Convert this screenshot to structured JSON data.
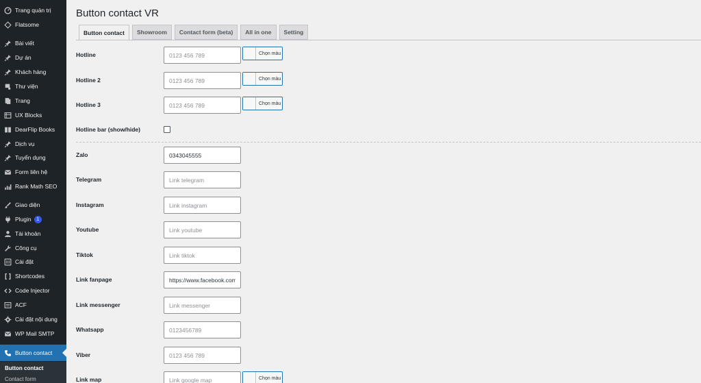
{
  "sidebar": {
    "items": [
      {
        "label": "Trang quản trị",
        "icon": "dashboard-icon"
      },
      {
        "label": "Flatsome",
        "icon": "diamond-icon"
      },
      {
        "label": "Bài viết",
        "icon": "pin-icon"
      },
      {
        "label": "Dự án",
        "icon": "pin-icon"
      },
      {
        "label": "Khách hàng",
        "icon": "pin-icon"
      },
      {
        "label": "Thư viện",
        "icon": "media-icon"
      },
      {
        "label": "Trang",
        "icon": "page-icon"
      },
      {
        "label": "UX Blocks",
        "icon": "blocks-icon"
      },
      {
        "label": "DearFlip Books",
        "icon": "book-icon"
      },
      {
        "label": "Dịch vụ",
        "icon": "pin-icon"
      },
      {
        "label": "Tuyển dụng",
        "icon": "pin-icon"
      },
      {
        "label": "Form liên hệ",
        "icon": "mail-icon"
      },
      {
        "label": "Rank Math SEO",
        "icon": "chart-icon"
      },
      {
        "label": "Giao diện",
        "icon": "brush-icon"
      },
      {
        "label": "Plugin",
        "icon": "plugin-icon",
        "badge": "1"
      },
      {
        "label": "Tài khoản",
        "icon": "user-icon"
      },
      {
        "label": "Công cụ",
        "icon": "wrench-icon"
      },
      {
        "label": "Cài đặt",
        "icon": "settings-icon"
      },
      {
        "label": "Shortcodes",
        "icon": "brackets-icon"
      },
      {
        "label": "Code Injector",
        "icon": "code-icon"
      },
      {
        "label": "ACF",
        "icon": "acf-icon"
      },
      {
        "label": "Cài đặt nội dung",
        "icon": "gear-icon"
      },
      {
        "label": "WP Mail SMTP",
        "icon": "mail-icon"
      },
      {
        "label": "Button contact",
        "icon": "phone-icon",
        "active": true
      }
    ],
    "submenu": [
      {
        "label": "Button contact",
        "current": true
      },
      {
        "label": "Contact form",
        "current": false
      }
    ]
  },
  "page": {
    "title": "Button contact VR",
    "tabs": [
      "Button contact",
      "Showroom",
      "Contact form (beta)",
      "All in one",
      "Setting"
    ],
    "active_tab": 0
  },
  "form": {
    "color_label": "Chọn màu",
    "fields": [
      {
        "label": "Hotline",
        "placeholder": "0123 456 789",
        "value": "",
        "color": true
      },
      {
        "label": "Hotline 2",
        "placeholder": "0123 456 789",
        "value": "",
        "color": true
      },
      {
        "label": "Hotline 3",
        "placeholder": "0123 456 789",
        "value": "",
        "color": true
      },
      {
        "label": "Hotline bar (show/hide)",
        "type": "checkbox",
        "checked": false
      },
      {
        "label": "Zalo",
        "placeholder": "",
        "value": "0343045555"
      },
      {
        "label": "Telegram",
        "placeholder": "Link telegram",
        "value": ""
      },
      {
        "label": "Instagram",
        "placeholder": "Link instagram",
        "value": ""
      },
      {
        "label": "Youtube",
        "placeholder": "Link youtube",
        "value": ""
      },
      {
        "label": "Tiktok",
        "placeholder": "Link tiktok",
        "value": ""
      },
      {
        "label": "Link fanpage",
        "placeholder": "",
        "value": "https://www.facebook.com"
      },
      {
        "label": "Link messenger",
        "placeholder": "Link messenger",
        "value": ""
      },
      {
        "label": "Whatsapp",
        "placeholder": "0123456789",
        "value": ""
      },
      {
        "label": "Viber",
        "placeholder": "0123 456 789",
        "value": ""
      },
      {
        "label": "Link map",
        "placeholder": "Link google map",
        "value": "",
        "color": true
      }
    ]
  },
  "colors": {
    "sidebar_bg": "#1d2327",
    "accent": "#2271b1",
    "page_bg": "#f0f0f1"
  }
}
